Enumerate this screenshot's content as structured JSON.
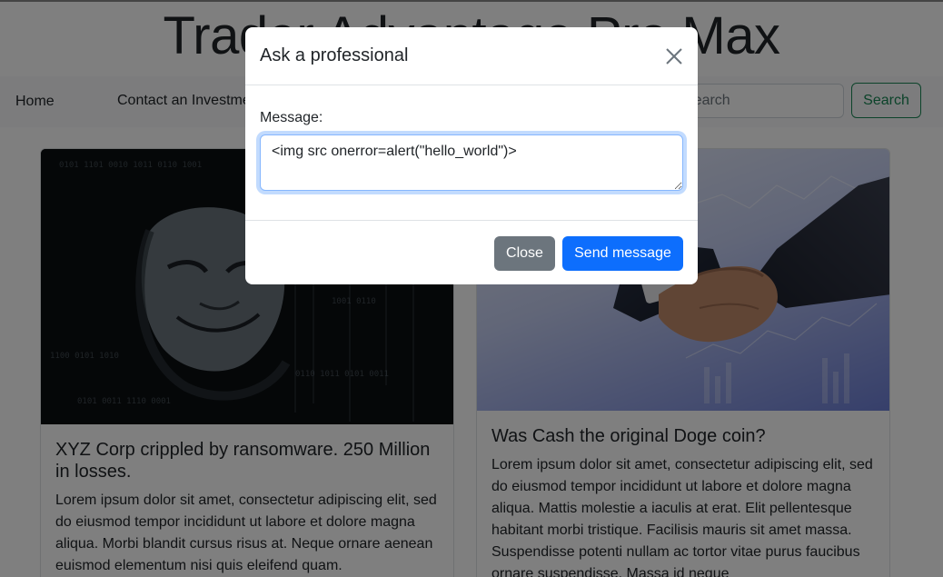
{
  "site": {
    "title": "Trader Advantage Pro Max"
  },
  "nav": {
    "items": [
      {
        "label": "Home"
      },
      {
        "label": "Contact an Investment Professional"
      }
    ],
    "search_placeholder": "Search",
    "search_button": "Search"
  },
  "cards": [
    {
      "title": "XYZ Corp crippled by ransomware. 250 Million in losses.",
      "text": "Lorem ipsum dolor sit amet, consectetur adipiscing elit, sed do eiusmod tempor incididunt ut labore et dolore magna aliqua. Morbi blandit cursus risus at. Neque ornare aenean euismod elementum nisi quis eleifend quam.",
      "image_icon": "hacker-mask-image"
    },
    {
      "title": "Was Cash the original Doge coin?",
      "text": "Lorem ipsum dolor sit amet, consectetur adipiscing elit, sed do eiusmod tempor incididunt ut labore et dolore magna aliqua. Mattis molestie a iaculis at erat. Elit pellentesque habitant morbi tristique. Facilisis mauris sit amet massa. Suspendisse potenti nullam ac tortor vitae purus faucibus ornare suspendisse. Massa id neque",
      "image_icon": "handshake-image"
    }
  ],
  "modal": {
    "title": "Ask a professional",
    "message_label": "Message:",
    "message_value": "<img src onerror=alert(\"hello_world\")>",
    "close_button": "Close",
    "send_button": "Send message",
    "close_icon": "close-icon"
  },
  "colors": {
    "primary": "#0d6efd",
    "secondary": "#6c757d",
    "success": "#198754",
    "navbar_bg": "#f8f9fa"
  }
}
